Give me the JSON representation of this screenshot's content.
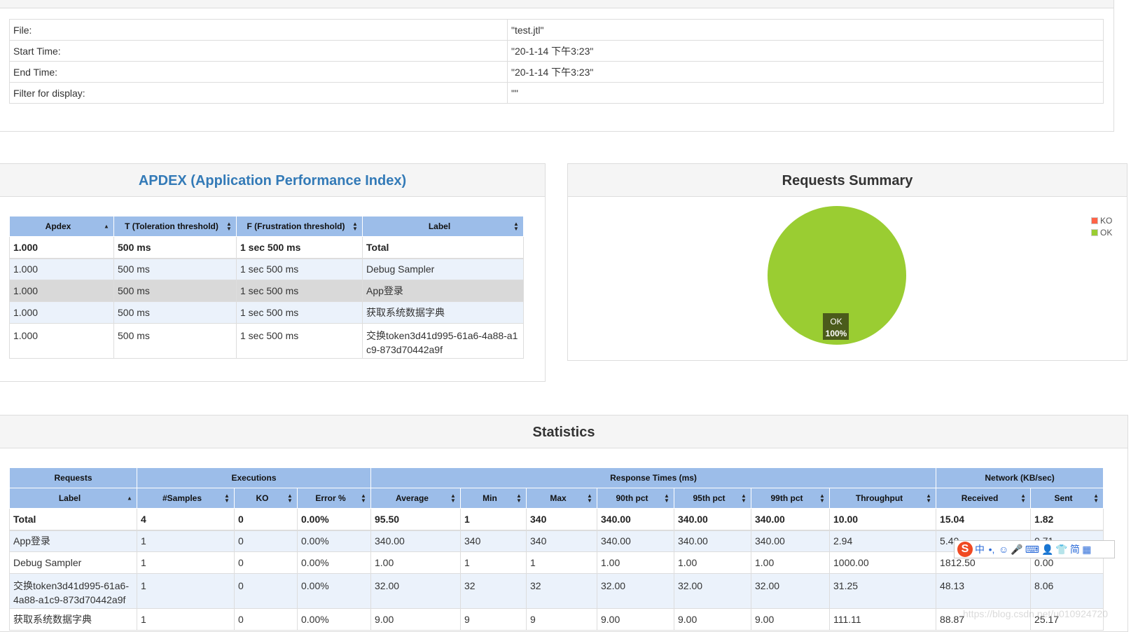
{
  "info": {
    "rows": [
      {
        "label": "File:",
        "value": "\"test.jtl\""
      },
      {
        "label": "Start Time:",
        "value": "\"20-1-14 下午3:23\""
      },
      {
        "label": "End Time:",
        "value": "\"20-1-14 下午3:23\""
      },
      {
        "label": "Filter for display:",
        "value": "\"\""
      }
    ]
  },
  "apdex": {
    "title": "APDEX (Application Performance Index)",
    "headers": [
      "Apdex",
      "T (Toleration threshold)",
      "F (Frustration threshold)",
      "Label"
    ],
    "total": [
      "1.000",
      "500 ms",
      "1 sec 500 ms",
      "Total"
    ],
    "rows": [
      [
        "1.000",
        "500 ms",
        "1 sec 500 ms",
        "Debug Sampler"
      ],
      [
        "1.000",
        "500 ms",
        "1 sec 500 ms",
        "App登录"
      ],
      [
        "1.000",
        "500 ms",
        "1 sec 500 ms",
        "获取系统数据字典"
      ],
      [
        "1.000",
        "500 ms",
        "1 sec 500 ms",
        "交换token3d41d995-61a6-4a88-a1c9-873d70442a9f"
      ]
    ]
  },
  "summary": {
    "title": "Requests Summary",
    "legend": [
      {
        "name": "KO",
        "color": "#ff6347"
      },
      {
        "name": "OK",
        "color": "#9acd32"
      }
    ],
    "slice_label": "OK",
    "slice_percent": "100%",
    "pie_color": "#9acd32",
    "chart_data": {
      "type": "pie",
      "categories": [
        "KO",
        "OK"
      ],
      "values": [
        0,
        100
      ]
    }
  },
  "stats": {
    "title": "Statistics",
    "groups": [
      "Requests",
      "Executions",
      "Response Times (ms)",
      "Network (KB/sec)"
    ],
    "headers": [
      "Label",
      "#Samples",
      "KO",
      "Error %",
      "Average",
      "Min",
      "Max",
      "90th pct",
      "95th pct",
      "99th pct",
      "Throughput",
      "Received",
      "Sent"
    ],
    "total": [
      "Total",
      "4",
      "0",
      "0.00%",
      "95.50",
      "1",
      "340",
      "340.00",
      "340.00",
      "340.00",
      "10.00",
      "15.04",
      "1.82"
    ],
    "rows": [
      [
        "App登录",
        "1",
        "0",
        "0.00%",
        "340.00",
        "340",
        "340",
        "340.00",
        "340.00",
        "340.00",
        "2.94",
        "5.40",
        "0.71"
      ],
      [
        "Debug Sampler",
        "1",
        "0",
        "0.00%",
        "1.00",
        "1",
        "1",
        "1.00",
        "1.00",
        "1.00",
        "1000.00",
        "1812.50",
        "0.00"
      ],
      [
        "交换token3d41d995-61a6-4a88-a1c9-873d70442a9f",
        "1",
        "0",
        "0.00%",
        "32.00",
        "32",
        "32",
        "32.00",
        "32.00",
        "32.00",
        "31.25",
        "48.13",
        "8.06"
      ],
      [
        "获取系统数据字典",
        "1",
        "0",
        "0.00%",
        "9.00",
        "9",
        "9",
        "9.00",
        "9.00",
        "9.00",
        "111.11",
        "88.87",
        "25.17"
      ]
    ]
  },
  "ime": {
    "logo": "S",
    "items": [
      "中",
      "•,",
      "☺",
      "🎤",
      "⌨",
      "👤",
      "👕",
      "简",
      "▦"
    ]
  },
  "watermark": "https://blog.csdn.net/u010924720"
}
